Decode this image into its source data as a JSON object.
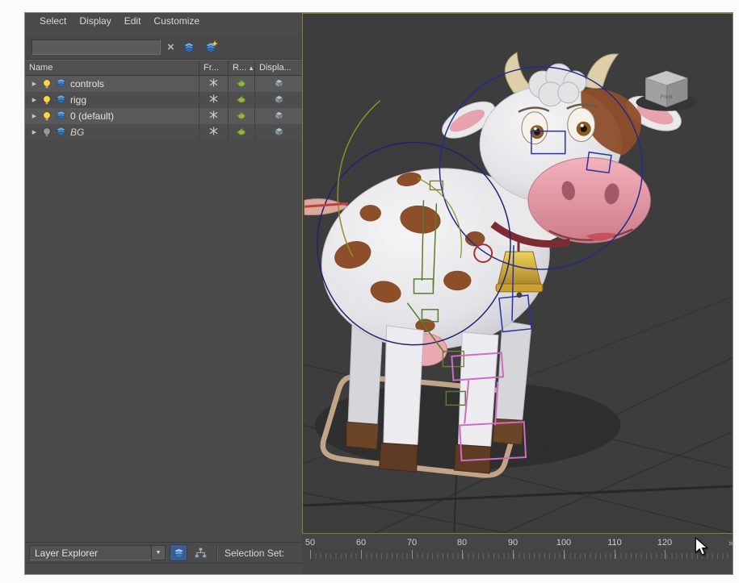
{
  "menu": {
    "items": [
      {
        "label": "Select"
      },
      {
        "label": "Display"
      },
      {
        "label": "Edit"
      },
      {
        "label": "Customize"
      }
    ]
  },
  "search": {
    "value": ""
  },
  "icons": {
    "expand": "▶",
    "clear": "×",
    "dropdown": "▼",
    "sort_asc": "▲",
    "end_arrows": "»"
  },
  "explorer": {
    "headers": {
      "name": "Name",
      "frozen": "Fr...",
      "render": "R...",
      "display": "Displa..."
    },
    "rows": [
      {
        "name": "controls"
      },
      {
        "name": "rigg"
      },
      {
        "name": "0 (default)"
      },
      {
        "name": "BG"
      }
    ]
  },
  "statusbar": {
    "mode": "Layer Explorer",
    "selection_label": "Selection Set:"
  },
  "timeline": {
    "ticks": [
      {
        "label": "50"
      },
      {
        "label": "60"
      },
      {
        "label": "70"
      },
      {
        "label": "80"
      },
      {
        "label": "90"
      },
      {
        "label": "100"
      },
      {
        "label": "110"
      },
      {
        "label": "120"
      }
    ]
  },
  "viewport": {
    "viewcube_label": "Front"
  },
  "colors": {
    "viewport_border": "#8a7d2e",
    "layer_blue": "#4f8cc8",
    "spot_brown": "#8d4e2a",
    "bell_yellow": "#d8b83a",
    "rig_blue": "#2433a8",
    "rig_magenta": "#cf6cc0"
  }
}
